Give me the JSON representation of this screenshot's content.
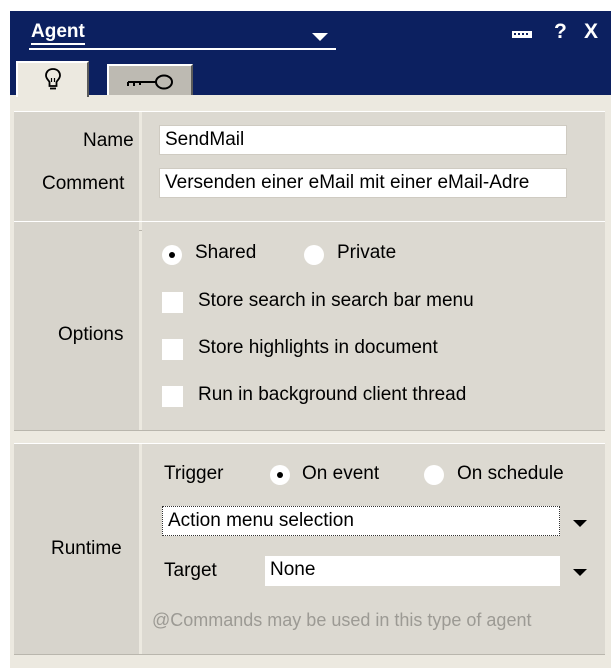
{
  "panel": {
    "title": "Agent",
    "buttons": {
      "pin_icon": "pin-icon",
      "help": "?",
      "close": "X"
    },
    "tabs": [
      {
        "icon": "lightbulb-icon",
        "selected": true
      },
      {
        "icon": "key-icon",
        "selected": false
      }
    ]
  },
  "basics": {
    "name_label": "Name",
    "name_value": "SendMail",
    "comment_label": "Comment",
    "comment_value": "Versenden einer eMail mit einer eMail-Adre"
  },
  "options": {
    "section_label": "Options",
    "shared_label": "Shared",
    "private_label": "Private",
    "shared_selected": true,
    "checkboxes": [
      {
        "label": "Store search in search bar menu",
        "checked": false
      },
      {
        "label": "Store highlights in document",
        "checked": false
      },
      {
        "label": "Run in background client thread",
        "checked": false
      }
    ]
  },
  "runtime": {
    "section_label": "Runtime",
    "trigger_label": "Trigger",
    "on_event_label": "On event",
    "on_schedule_label": "On schedule",
    "on_event_selected": true,
    "trigger_select_value": "Action menu selection",
    "target_label": "Target",
    "target_value": "None",
    "hint": "@Commands may be used in this type of agent"
  }
}
